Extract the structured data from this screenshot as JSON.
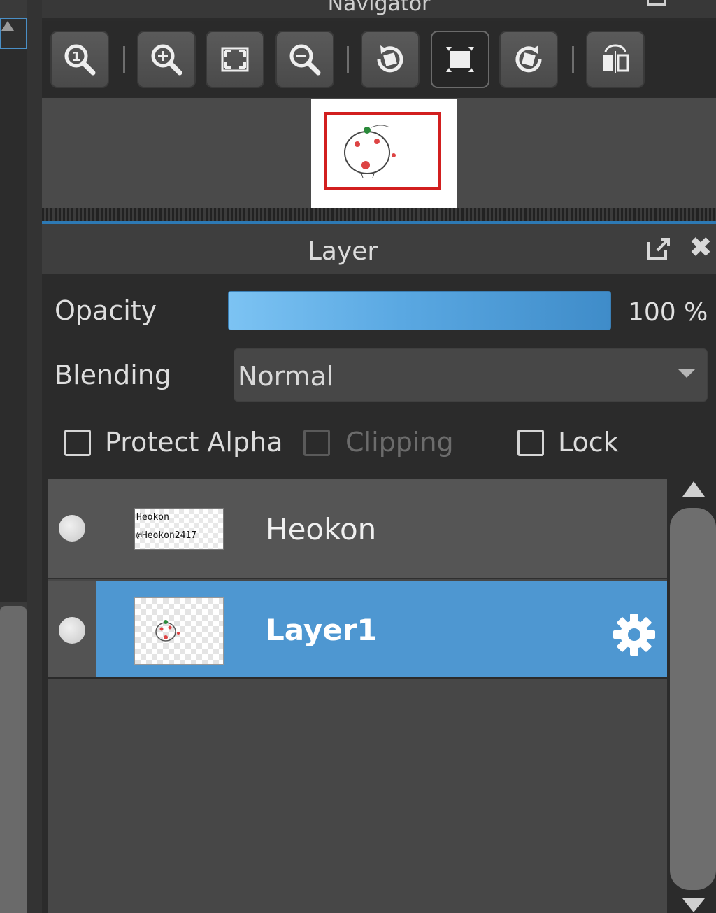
{
  "navigator": {
    "title": "Navigator",
    "toolbar": [
      {
        "name": "zoom-actual-size-icon"
      },
      {
        "name": "zoom-in-icon"
      },
      {
        "name": "fit-to-window-icon"
      },
      {
        "name": "zoom-out-icon"
      },
      {
        "name": "rotate-left-icon"
      },
      {
        "name": "reset-rotation-icon",
        "active": true
      },
      {
        "name": "rotate-right-icon"
      },
      {
        "name": "flip-horizontal-icon"
      }
    ]
  },
  "layer_panel": {
    "title": "Layer",
    "opacity": {
      "label": "Opacity",
      "value": "100 %",
      "fraction": 1.0
    },
    "blending": {
      "label": "Blending",
      "value": "Normal"
    },
    "options": {
      "protect_alpha": {
        "label": "Protect Alpha",
        "checked": false
      },
      "clipping": {
        "label": "Clipping",
        "checked": false,
        "disabled": true
      },
      "lock": {
        "label": "Lock",
        "checked": false
      }
    },
    "layers": [
      {
        "name": "Heokon",
        "thumb_text": [
          "Heokon",
          "@Heokon2417"
        ],
        "selected": false
      },
      {
        "name": "Layer1",
        "selected": true
      }
    ]
  },
  "colors": {
    "accent": "#4e97d1",
    "nav_frame": "#d21f1f"
  }
}
